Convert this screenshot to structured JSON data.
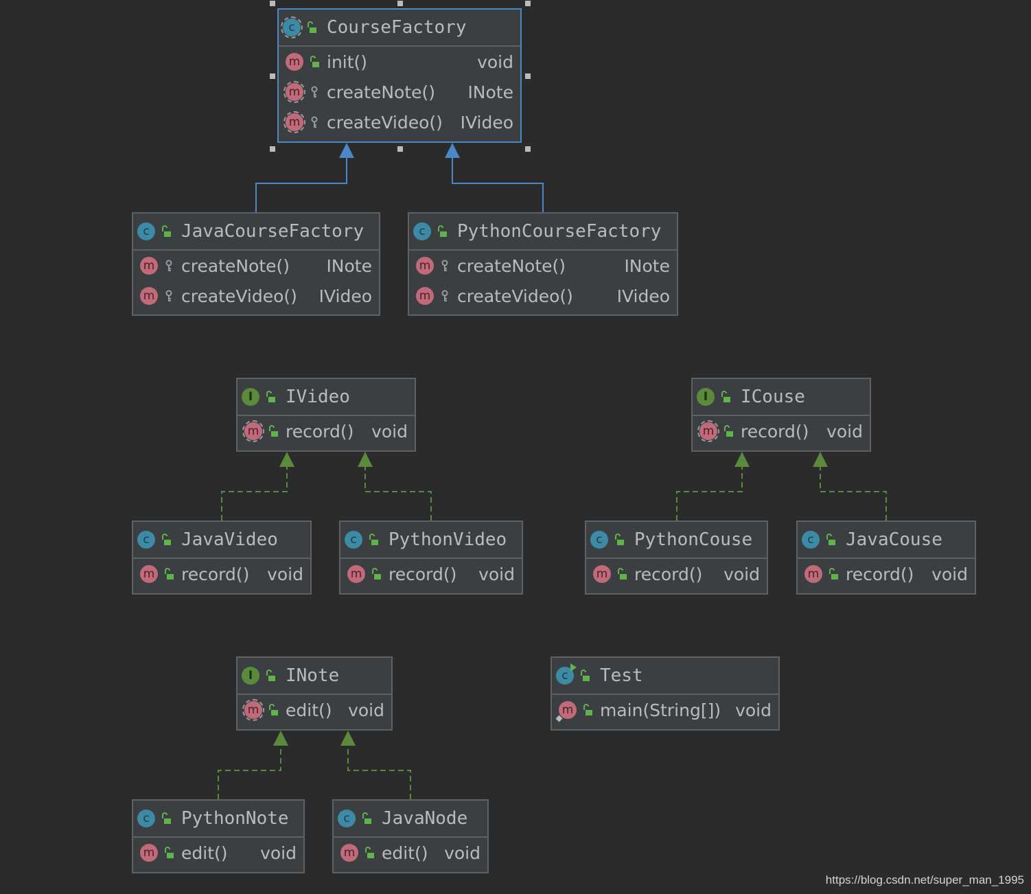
{
  "colors": {
    "background": "#2b2b2b",
    "box_fill": "#3c3f41",
    "box_border": "#5e6164",
    "selected_border": "#4a88c7",
    "extends_arrow": "#4a88c7",
    "implements_arrow": "#5c8a3c",
    "text": "#bbbbbb",
    "class_icon": "#3d8aa6",
    "interface_icon": "#5c8a3c",
    "method_icon": "#c06a7a"
  },
  "nodes": {
    "course_factory": {
      "kind": "class",
      "kind_letter": "c",
      "abstract": true,
      "name": "CourseFactory",
      "selected": true,
      "methods": [
        {
          "name": "init()",
          "type": "void",
          "visibility": "public",
          "abstract": false
        },
        {
          "name": "createNote()",
          "type": "INote",
          "visibility": "protected",
          "abstract": true
        },
        {
          "name": "createVideo()",
          "type": "IVideo",
          "visibility": "protected",
          "abstract": true
        }
      ]
    },
    "java_course_factory": {
      "kind": "class",
      "kind_letter": "c",
      "name": "JavaCourseFactory",
      "methods": [
        {
          "name": "createNote()",
          "type": "INote",
          "visibility": "protected"
        },
        {
          "name": "createVideo()",
          "type": "IVideo",
          "visibility": "protected"
        }
      ]
    },
    "python_course_factory": {
      "kind": "class",
      "kind_letter": "c",
      "name": "PythonCourseFactory",
      "methods": [
        {
          "name": "createNote()",
          "type": "INote",
          "visibility": "protected"
        },
        {
          "name": "createVideo()",
          "type": "IVideo",
          "visibility": "protected"
        }
      ]
    },
    "ivideo": {
      "kind": "interface",
      "kind_letter": "I",
      "name": "IVideo",
      "methods": [
        {
          "name": "record()",
          "type": "void",
          "visibility": "public",
          "abstract": true
        }
      ]
    },
    "icouse": {
      "kind": "interface",
      "kind_letter": "I",
      "name": "ICouse",
      "methods": [
        {
          "name": "record()",
          "type": "void",
          "visibility": "public",
          "abstract": true
        }
      ]
    },
    "java_video": {
      "kind": "class",
      "kind_letter": "c",
      "name": "JavaVideo",
      "methods": [
        {
          "name": "record()",
          "type": "void",
          "visibility": "public"
        }
      ]
    },
    "python_video": {
      "kind": "class",
      "kind_letter": "c",
      "name": "PythonVideo",
      "methods": [
        {
          "name": "record()",
          "type": "void",
          "visibility": "public"
        }
      ]
    },
    "python_couse": {
      "kind": "class",
      "kind_letter": "c",
      "name": "PythonCouse",
      "methods": [
        {
          "name": "record()",
          "type": "void",
          "visibility": "public"
        }
      ]
    },
    "java_couse": {
      "kind": "class",
      "kind_letter": "c",
      "name": "JavaCouse",
      "methods": [
        {
          "name": "record()",
          "type": "void",
          "visibility": "public"
        }
      ]
    },
    "inote": {
      "kind": "interface",
      "kind_letter": "I",
      "name": "INote",
      "methods": [
        {
          "name": "edit()",
          "type": "void",
          "visibility": "public",
          "abstract": true
        }
      ]
    },
    "test": {
      "kind": "class",
      "kind_letter": "c",
      "name": "Test",
      "runnable": true,
      "methods": [
        {
          "name": "main(String[])",
          "type": "void",
          "visibility": "public",
          "static": true
        }
      ]
    },
    "python_note": {
      "kind": "class",
      "kind_letter": "c",
      "name": "PythonNote",
      "methods": [
        {
          "name": "edit()",
          "type": "void",
          "visibility": "public"
        }
      ]
    },
    "java_node": {
      "kind": "class",
      "kind_letter": "c",
      "name": "JavaNode",
      "methods": [
        {
          "name": "edit()",
          "type": "void",
          "visibility": "public"
        }
      ]
    }
  },
  "edges": [
    {
      "from": "java_course_factory",
      "to": "course_factory",
      "relation": "extends"
    },
    {
      "from": "python_course_factory",
      "to": "course_factory",
      "relation": "extends"
    },
    {
      "from": "java_video",
      "to": "ivideo",
      "relation": "implements"
    },
    {
      "from": "python_video",
      "to": "ivideo",
      "relation": "implements"
    },
    {
      "from": "python_couse",
      "to": "icouse",
      "relation": "implements"
    },
    {
      "from": "java_couse",
      "to": "icouse",
      "relation": "implements"
    },
    {
      "from": "python_note",
      "to": "inote",
      "relation": "implements"
    },
    {
      "from": "java_node",
      "to": "inote",
      "relation": "implements"
    }
  ],
  "watermark": "https://blog.csdn.net/super_man_1995"
}
